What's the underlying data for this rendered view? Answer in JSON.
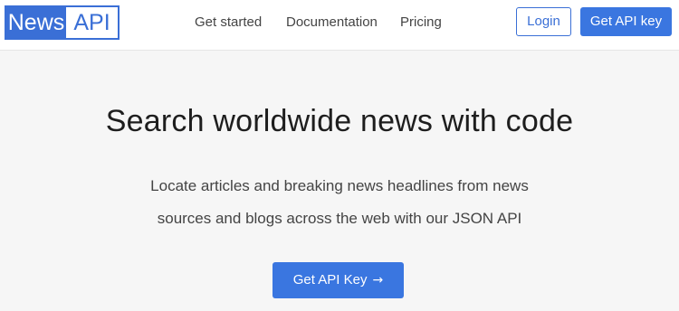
{
  "logo": {
    "news": "News",
    "api": "API"
  },
  "nav": {
    "items": [
      {
        "label": "Get started"
      },
      {
        "label": "Documentation"
      },
      {
        "label": "Pricing"
      }
    ],
    "login_label": "Login",
    "get_key_label": "Get API key"
  },
  "hero": {
    "title": "Search worldwide news with code",
    "subtitle_line1": "Locate articles and breaking news headlines from news",
    "subtitle_line2": "sources and blogs across the web with our JSON API",
    "cta_label": "Get API Key",
    "cta_icon": "arrow-right-icon"
  },
  "colors": {
    "brand": "#3a6fd6",
    "button": "#3a76e0",
    "background": "#f6f6f6"
  }
}
